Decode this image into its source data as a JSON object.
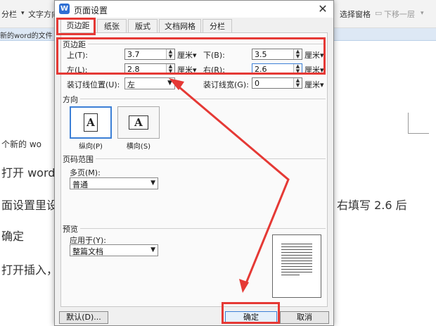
{
  "background": {
    "toolbar": {
      "columns_label": "分栏",
      "text_direction_label": "文字方向",
      "selection_pane_label": "选择窗格",
      "move_down_label": "下移一层"
    },
    "doc_tab_label": "新的word的文件",
    "doc_lines": [
      "个新的 wo",
      "打开 word",
      "面设置里设",
      "右填写 2.6 后",
      "确定",
      "打开插入，"
    ]
  },
  "dialog": {
    "title": "页面设置",
    "close_glyph": "✕",
    "tabs": [
      "页边距",
      "纸张",
      "版式",
      "文档网格",
      "分栏"
    ],
    "margins": {
      "group_label": "页边距",
      "top_label": "上(T):",
      "top_value": "3.7",
      "bottom_label": "下(B):",
      "bottom_value": "3.5",
      "left_label": "左(L):",
      "left_value": "2.8",
      "right_label": "右(R):",
      "right_value": "2.6",
      "unit": "厘米",
      "gutter_pos_label": "装订线位置(U):",
      "gutter_pos_value": "左",
      "gutter_width_label": "装订线宽(G):",
      "gutter_width_value": "0"
    },
    "orientation": {
      "group_label": "方向",
      "portrait_label": "纵向(P)",
      "landscape_label": "横向(S)",
      "glyph": "A"
    },
    "page_range": {
      "group_label": "页码范围",
      "multiple_pages_label": "多页(M):",
      "multiple_pages_value": "普通"
    },
    "preview": {
      "group_label": "预览",
      "apply_to_label": "应用于(Y):",
      "apply_to_value": "整篇文档"
    },
    "buttons": {
      "default_label": "默认(D)...",
      "ok_label": "确定",
      "cancel_label": "取消"
    }
  },
  "colors": {
    "annotation": "#e53935",
    "accent": "#3c7fd6",
    "app_icon": "#2f6fd3"
  }
}
